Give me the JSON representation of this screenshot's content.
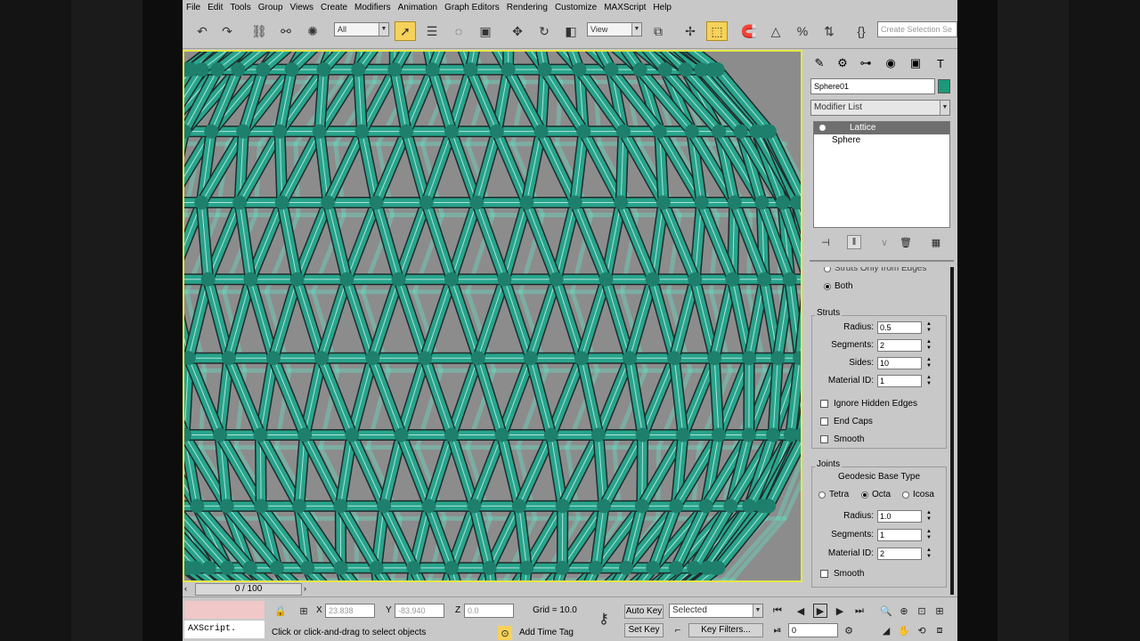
{
  "menu": [
    "File",
    "Edit",
    "Tools",
    "Group",
    "Views",
    "Create",
    "Modifiers",
    "Animation",
    "Graph Editors",
    "Rendering",
    "Customize",
    "MAXScript",
    "Help"
  ],
  "toolbar": {
    "selection_filter": "All",
    "ref_coord": "View",
    "named_selection_placeholder": "Create Selection Se"
  },
  "command_panel": {
    "object_name": "Sphere01",
    "object_color": "#1a9a7a",
    "modifier_list_label": "Modifier List",
    "stack": [
      {
        "label": "Lattice",
        "selected": true
      },
      {
        "label": "Sphere",
        "selected": false
      }
    ],
    "geometry": {
      "partial_option": "Struts Only from Edges",
      "both_label": "Both"
    },
    "struts": {
      "title": "Struts",
      "radius_label": "Radius:",
      "radius": "0.5",
      "segments_label": "Segments:",
      "segments": "2",
      "sides_label": "Sides:",
      "sides": "10",
      "material_id_label": "Material ID:",
      "material_id": "1",
      "ignore_hidden_edges": "Ignore Hidden Edges",
      "end_caps": "End Caps",
      "smooth": "Smooth"
    },
    "joints": {
      "title": "Joints",
      "base_type_label": "Geodesic Base Type",
      "tetra": "Tetra",
      "octa": "Octa",
      "icosa": "Icosa",
      "radius_label": "Radius:",
      "radius": "1.0",
      "segments_label": "Segments:",
      "segments": "1",
      "material_id_label": "Material ID:",
      "material_id": "2",
      "smooth": "Smooth"
    }
  },
  "timeline": {
    "frame": "0 / 100"
  },
  "status": {
    "maxscript_listener": "AXScript.",
    "x_label": "X",
    "x": "23.838",
    "y_label": "Y",
    "y": "-83.940",
    "z_label": "Z",
    "z": "0.0",
    "grid": "Grid = 10.0",
    "prompt": "Click or click-and-drag to select objects",
    "add_time_tag": "Add Time Tag",
    "auto_key": "Auto Key",
    "set_key": "Set Key",
    "key_filter_selected": "Selected",
    "key_filters": "Key Filters...",
    "current_frame": "0"
  },
  "colors": {
    "lattice": "#28a48c",
    "viewport_bg": "#8c8c8c",
    "active_viewport_border": "#e6e64a"
  }
}
